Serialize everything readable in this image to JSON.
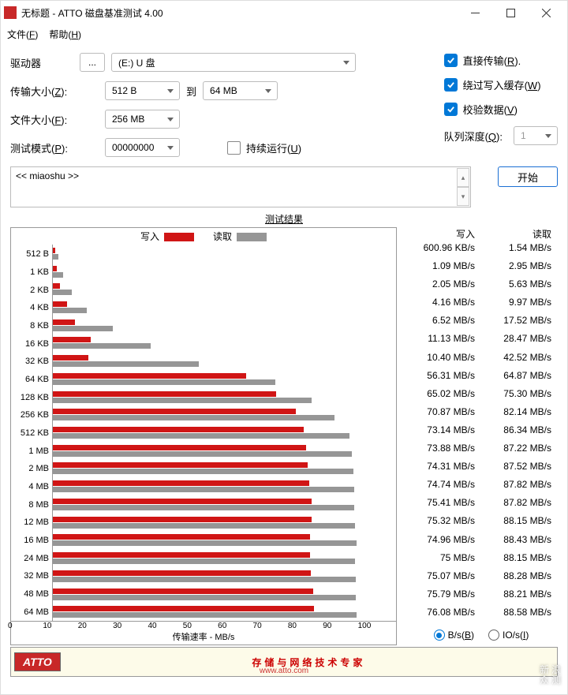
{
  "window": {
    "title": "无标题 - ATTO 磁盘基准测试 4.00"
  },
  "menu": {
    "file": "文件(F)",
    "help": "帮助(H)"
  },
  "labels": {
    "drive": "驱动器",
    "transfer_size": "传输大小(Z):",
    "file_size": "文件大小(F):",
    "test_mode": "测试模式(P):",
    "to": "到",
    "continuous": "持续运行(U)",
    "direct_io": "直接传输(R).",
    "bypass_write_cache": "绕过写入缓存(W)",
    "verify_data": "校验数据(V)",
    "queue_depth": "队列深度(Q):",
    "start": "开始",
    "results_title": "测试结果",
    "write_legend": "写入",
    "read_legend": "读取",
    "xaxis": "传输速率 - MB/s",
    "bytes_sec": "B/s(B)",
    "io_sec": "IO/s(I)",
    "dots": "..."
  },
  "values": {
    "drive": "(E:) U 盘",
    "size_from": "512 B",
    "size_to": "64 MB",
    "file_size": "256 MB",
    "test_mode": "00000000",
    "queue_depth": "1",
    "description": "<< miaoshu >>"
  },
  "footer": {
    "brand": "ATTO",
    "slogan": "存储与网络技术专家",
    "url": "www.atto.com"
  },
  "watermark": {
    "line1": "新浪",
    "line2": "众测"
  },
  "chart_data": {
    "type": "bar",
    "xlabel": "传输速率 - MB/s",
    "xlim": [
      0,
      100
    ],
    "xticks": [
      0,
      10,
      20,
      30,
      40,
      50,
      60,
      70,
      80,
      90,
      100
    ],
    "series": [
      {
        "name": "写入",
        "unit": "MB/s",
        "color": "#d01515"
      },
      {
        "name": "读取",
        "unit": "MB/s",
        "color": "#969696"
      }
    ],
    "rows": [
      {
        "label": "512 B",
        "write": 0.587,
        "read": 1.54,
        "write_display": "600.96 KB/s",
        "read_display": "1.54 MB/s"
      },
      {
        "label": "1 KB",
        "write": 1.09,
        "read": 2.95,
        "write_display": "1.09 MB/s",
        "read_display": "2.95 MB/s"
      },
      {
        "label": "2 KB",
        "write": 2.05,
        "read": 5.63,
        "write_display": "2.05 MB/s",
        "read_display": "5.63 MB/s"
      },
      {
        "label": "4 KB",
        "write": 4.16,
        "read": 9.97,
        "write_display": "4.16 MB/s",
        "read_display": "9.97 MB/s"
      },
      {
        "label": "8 KB",
        "write": 6.52,
        "read": 17.52,
        "write_display": "6.52 MB/s",
        "read_display": "17.52 MB/s"
      },
      {
        "label": "16 KB",
        "write": 11.13,
        "read": 28.47,
        "write_display": "11.13 MB/s",
        "read_display": "28.47 MB/s"
      },
      {
        "label": "32 KB",
        "write": 10.4,
        "read": 42.52,
        "write_display": "10.40 MB/s",
        "read_display": "42.52 MB/s"
      },
      {
        "label": "64 KB",
        "write": 56.31,
        "read": 64.87,
        "write_display": "56.31 MB/s",
        "read_display": "64.87 MB/s"
      },
      {
        "label": "128 KB",
        "write": 65.02,
        "read": 75.3,
        "write_display": "65.02 MB/s",
        "read_display": "75.30 MB/s"
      },
      {
        "label": "256 KB",
        "write": 70.87,
        "read": 82.14,
        "write_display": "70.87 MB/s",
        "read_display": "82.14 MB/s"
      },
      {
        "label": "512 KB",
        "write": 73.14,
        "read": 86.34,
        "write_display": "73.14 MB/s",
        "read_display": "86.34 MB/s"
      },
      {
        "label": "1 MB",
        "write": 73.88,
        "read": 87.22,
        "write_display": "73.88 MB/s",
        "read_display": "87.22 MB/s"
      },
      {
        "label": "2 MB",
        "write": 74.31,
        "read": 87.52,
        "write_display": "74.31 MB/s",
        "read_display": "87.52 MB/s"
      },
      {
        "label": "4 MB",
        "write": 74.74,
        "read": 87.82,
        "write_display": "74.74 MB/s",
        "read_display": "87.82 MB/s"
      },
      {
        "label": "8 MB",
        "write": 75.41,
        "read": 87.82,
        "write_display": "75.41 MB/s",
        "read_display": "87.82 MB/s"
      },
      {
        "label": "12 MB",
        "write": 75.32,
        "read": 88.15,
        "write_display": "75.32 MB/s",
        "read_display": "88.15 MB/s"
      },
      {
        "label": "16 MB",
        "write": 74.96,
        "read": 88.43,
        "write_display": "74.96 MB/s",
        "read_display": "88.43 MB/s"
      },
      {
        "label": "24 MB",
        "write": 75.0,
        "read": 88.15,
        "write_display": "75 MB/s",
        "read_display": "88.15 MB/s"
      },
      {
        "label": "32 MB",
        "write": 75.07,
        "read": 88.28,
        "write_display": "75.07 MB/s",
        "read_display": "88.28 MB/s"
      },
      {
        "label": "48 MB",
        "write": 75.79,
        "read": 88.21,
        "write_display": "75.79 MB/s",
        "read_display": "88.21 MB/s"
      },
      {
        "label": "64 MB",
        "write": 76.08,
        "read": 88.58,
        "write_display": "76.08 MB/s",
        "read_display": "88.58 MB/s"
      }
    ]
  }
}
